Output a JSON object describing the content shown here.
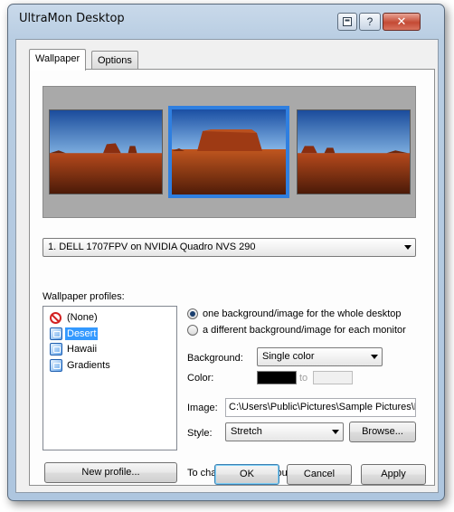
{
  "window": {
    "title": "UltraMon Desktop",
    "caption_buttons": {
      "help": "?",
      "close": "✕"
    }
  },
  "tabs": [
    {
      "label": "Wallpaper",
      "active": true
    },
    {
      "label": "Options",
      "active": false
    }
  ],
  "preview": {
    "monitors": [
      {
        "selected": false
      },
      {
        "selected": true
      },
      {
        "selected": false
      }
    ],
    "selection_color": "#2f7fe0"
  },
  "monitor_select": {
    "value": "1. DELL 1707FPV on NVIDIA Quadro NVS 290"
  },
  "profiles": {
    "label": "Wallpaper profiles:",
    "items": [
      {
        "label": "(None)",
        "icon": "no-icon",
        "selected": false
      },
      {
        "label": "Desert",
        "icon": "profile-icon",
        "selected": true
      },
      {
        "label": "Hawaii",
        "icon": "profile-icon",
        "selected": false
      },
      {
        "label": "Gradients",
        "icon": "profile-icon",
        "selected": false
      }
    ],
    "new_button": "New profile..."
  },
  "mode": {
    "option_whole": "one background/image for the whole desktop",
    "option_each": "a different background/image for each monitor",
    "selected": "whole"
  },
  "background": {
    "label": "Background:",
    "value": "Single color",
    "color_label": "Color:",
    "color_from": "#000000",
    "to_label": "to",
    "color_to": "#f0f0f0"
  },
  "image": {
    "label": "Image:",
    "path": "C:\\Users\\Public\\Pictures\\Sample Pictures\\D",
    "style_label": "Style:",
    "style_value": "Stretch",
    "browse_button": "Browse..."
  },
  "hint": "To change a color, double-click on it.",
  "footer": {
    "ok": "OK",
    "cancel": "Cancel",
    "apply": "Apply"
  },
  "colors": {
    "accent": "#3399ff",
    "title_bar": "#b8cde2"
  }
}
